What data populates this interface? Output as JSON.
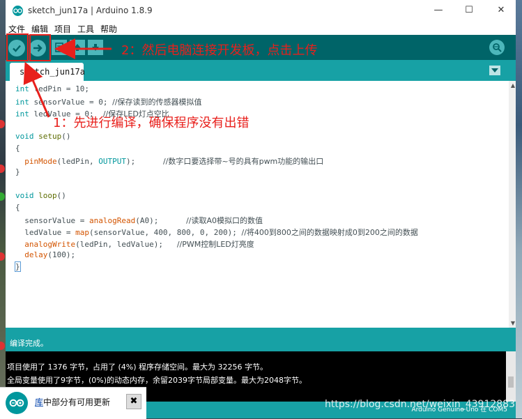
{
  "window": {
    "title": "sketch_jun17a | Arduino 1.8.9",
    "minimize": "—",
    "maximize": "☐",
    "close": "✕"
  },
  "menu": {
    "items": [
      "文件",
      "编辑",
      "项目",
      "工具",
      "帮助"
    ]
  },
  "toolbar": {
    "buttons": [
      {
        "name": "verify",
        "icon": "check-icon"
      },
      {
        "name": "upload",
        "icon": "arrow-right-icon"
      },
      {
        "name": "new",
        "icon": "new-file-icon"
      },
      {
        "name": "open",
        "icon": "arrow-up-icon"
      },
      {
        "name": "save",
        "icon": "arrow-down-icon"
      }
    ],
    "serial_monitor_icon": "magnifier-icon"
  },
  "tab": {
    "label": "sketch_jun17a"
  },
  "code": [
    "int ledPin = 10;",
    "int sensorValue = 0; //保存读到的传感器模拟值",
    "int ledValue = 0;  //保存LED灯点空比",
    "",
    "void setup()",
    "{",
    "  pinMode(ledPin, OUTPUT);      //数字口要选择带~号的具有pwm功能的输出口",
    "}",
    "",
    "void loop()",
    "{",
    "  sensorValue = analogRead(A0);      //读取A0模拟口的数值",
    "  ledValue = map(sensorValue, 400, 800, 0, 200); //将400到800之间的数据映射成0到200之间的数据",
    "  analogWrite(ledPin, ledValue);   //PWM控制LED灯亮度",
    "  delay(100);",
    "}"
  ],
  "status": {
    "message": "编译完成。"
  },
  "console": {
    "lines": [
      "项目使用了 1376 字节，占用了 (4%) 程序存储空间。最大为 32256 字节。",
      "全局变量使用了9字节，(0%)的动态内存，余留2039字节局部变量。最大为2048字节。"
    ]
  },
  "board": {
    "label": "Arduino Genuino Uno 在 COM5"
  },
  "notification": {
    "link_text": "库",
    "text": "中部分有可用更新",
    "close": "✖"
  },
  "annotations": {
    "step1": "1：先进行编译，确保程序没有出错",
    "step2": "2：然后电脑连接开发板，点击上传"
  },
  "watermark": "https://blog.csdn.net/weixin_43912883",
  "colors": {
    "teal": "#17a1a5",
    "toolbar": "#006468",
    "button": "#4db7bb",
    "annotation_red": "#e8201c"
  }
}
